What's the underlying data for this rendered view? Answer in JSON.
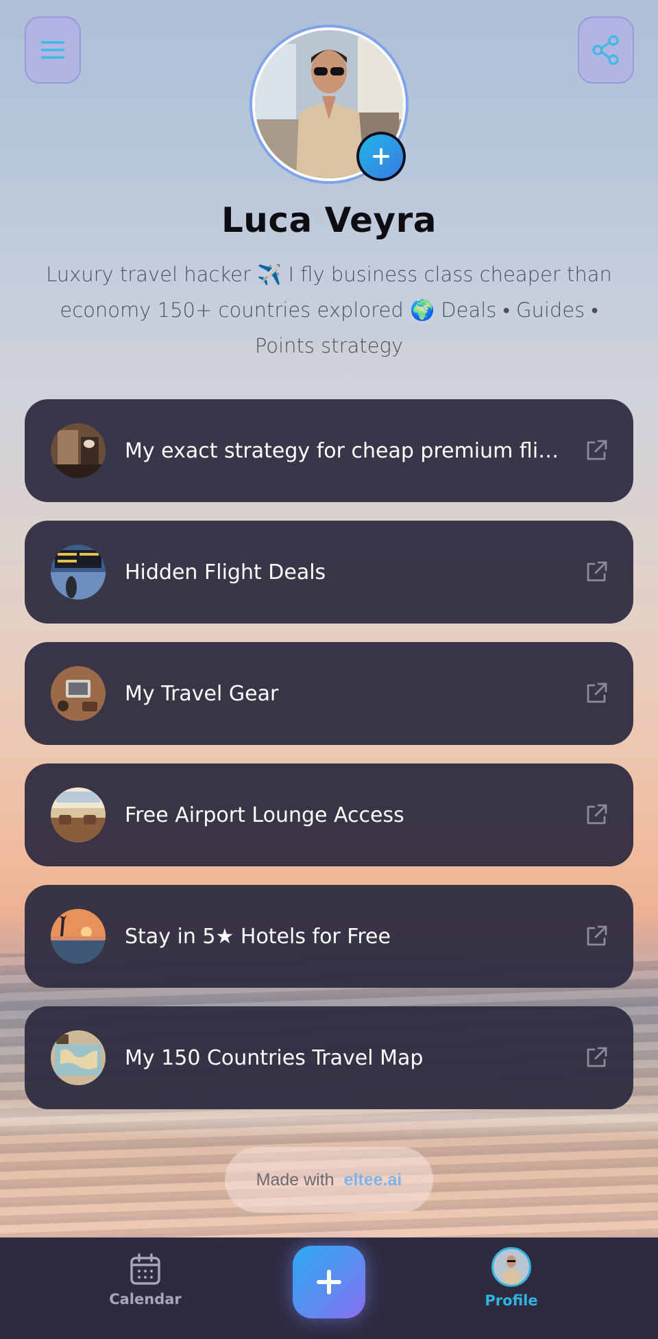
{
  "profile": {
    "name": "Luca Veyra",
    "bio": "Luxury travel hacker ✈️ I fly business class cheaper than economy 150+ countries explored 🌍 Deals • Guides • Points strategy"
  },
  "icons": {
    "menu": "menu-icon",
    "share": "share-icon",
    "add_photo": "plus-icon",
    "external_link": "external-link-icon",
    "calendar": "calendar-icon",
    "fab": "plus-icon"
  },
  "links": [
    {
      "label": "My exact strategy for cheap premium flights",
      "thumb": "airplane-cabin"
    },
    {
      "label": "Hidden Flight Deals",
      "thumb": "departure-board"
    },
    {
      "label": "My Travel Gear",
      "thumb": "travel-gear"
    },
    {
      "label": "Free Airport Lounge Access",
      "thumb": "airport-lounge"
    },
    {
      "label": "Stay in 5★ Hotels for Free",
      "thumb": "hotel-pool-sunset"
    },
    {
      "label": "My 150 Countries Travel Map",
      "thumb": "world-map"
    }
  ],
  "footer": {
    "made_with": "Made with",
    "brand": "eltee.ai"
  },
  "nav": {
    "calendar": "Calendar",
    "profile": "Profile"
  },
  "colors": {
    "accent": "#2fb4e0",
    "card": "#2e2c40",
    "nav_bg": "#2e2b40",
    "fab_start": "#2aa9f2",
    "fab_end": "#8a6fee"
  }
}
